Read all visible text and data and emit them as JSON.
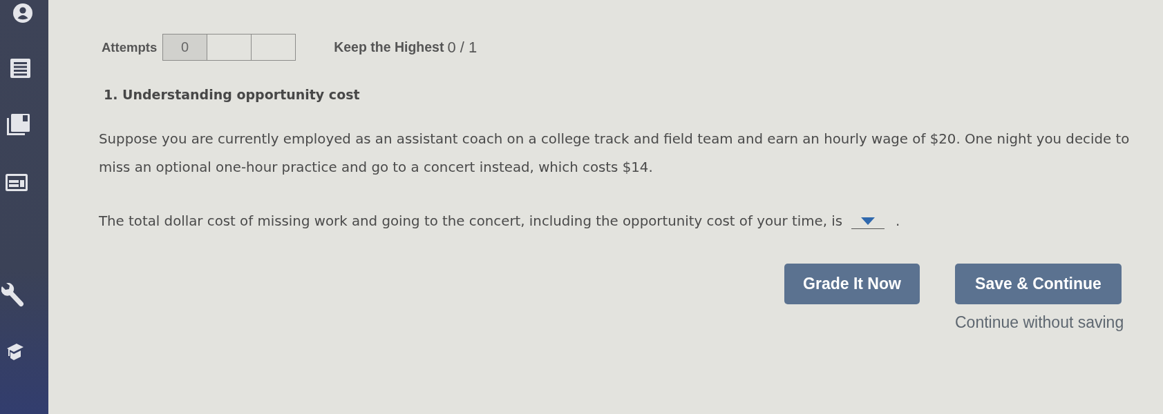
{
  "attempts": {
    "label": "Attempts",
    "boxes": [
      {
        "value": "0",
        "used": true
      },
      {
        "used": false
      },
      {
        "used": false
      }
    ],
    "policy": "Keep the Highest",
    "score": "0 / 1"
  },
  "question": {
    "title": "1. Understanding opportunity cost",
    "paragraphs": [
      "Suppose you are currently employed as an assistant coach on a college track and field team and earn an hourly wage of $20. One night you decide to miss an optional one-hour practice and go to a concert instead, which costs $14."
    ],
    "prompt": "The total dollar cost of missing work and going to the concert, including the opportunity cost of your time, is",
    "prompt_end": "."
  },
  "buttons": [
    {
      "label": "Grade It Now"
    },
    {
      "label": "Save & Continue"
    }
  ],
  "secondary_link": "Continue without saving"
}
